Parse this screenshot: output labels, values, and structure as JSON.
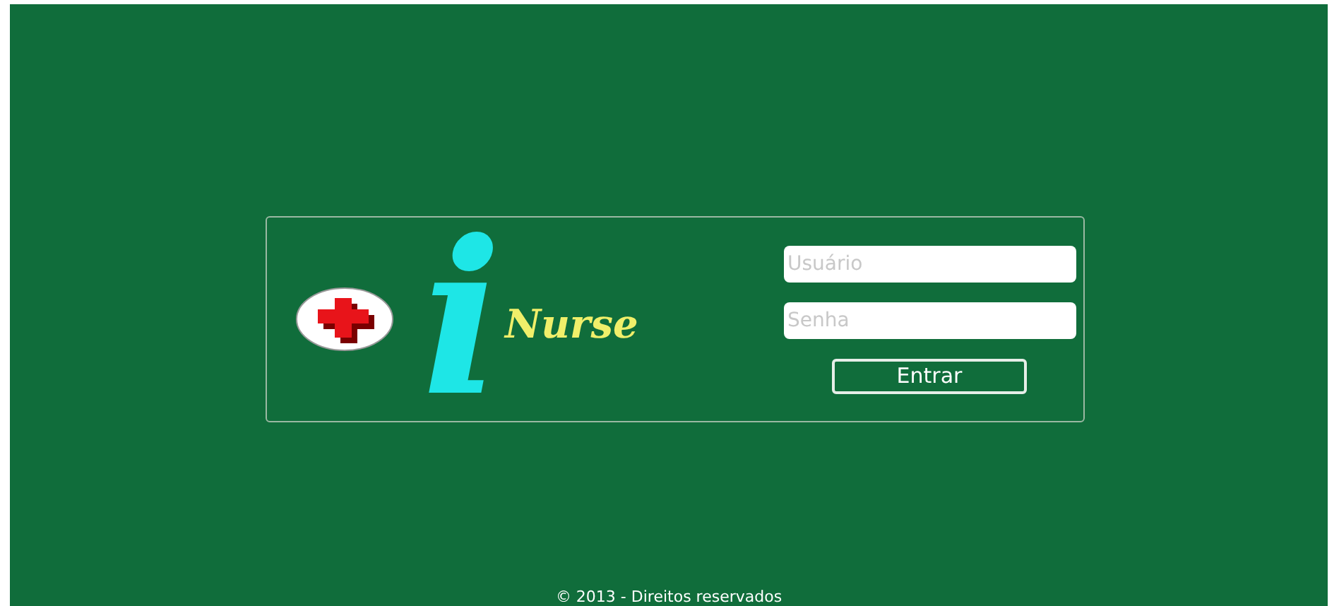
{
  "logo": {
    "letter": "i",
    "word": "Nurse"
  },
  "login": {
    "username": {
      "placeholder": "Usuário"
    },
    "password": {
      "placeholder": "Senha"
    },
    "submit": "Entrar"
  },
  "footer": "© 2013 - Direitos reservados"
}
